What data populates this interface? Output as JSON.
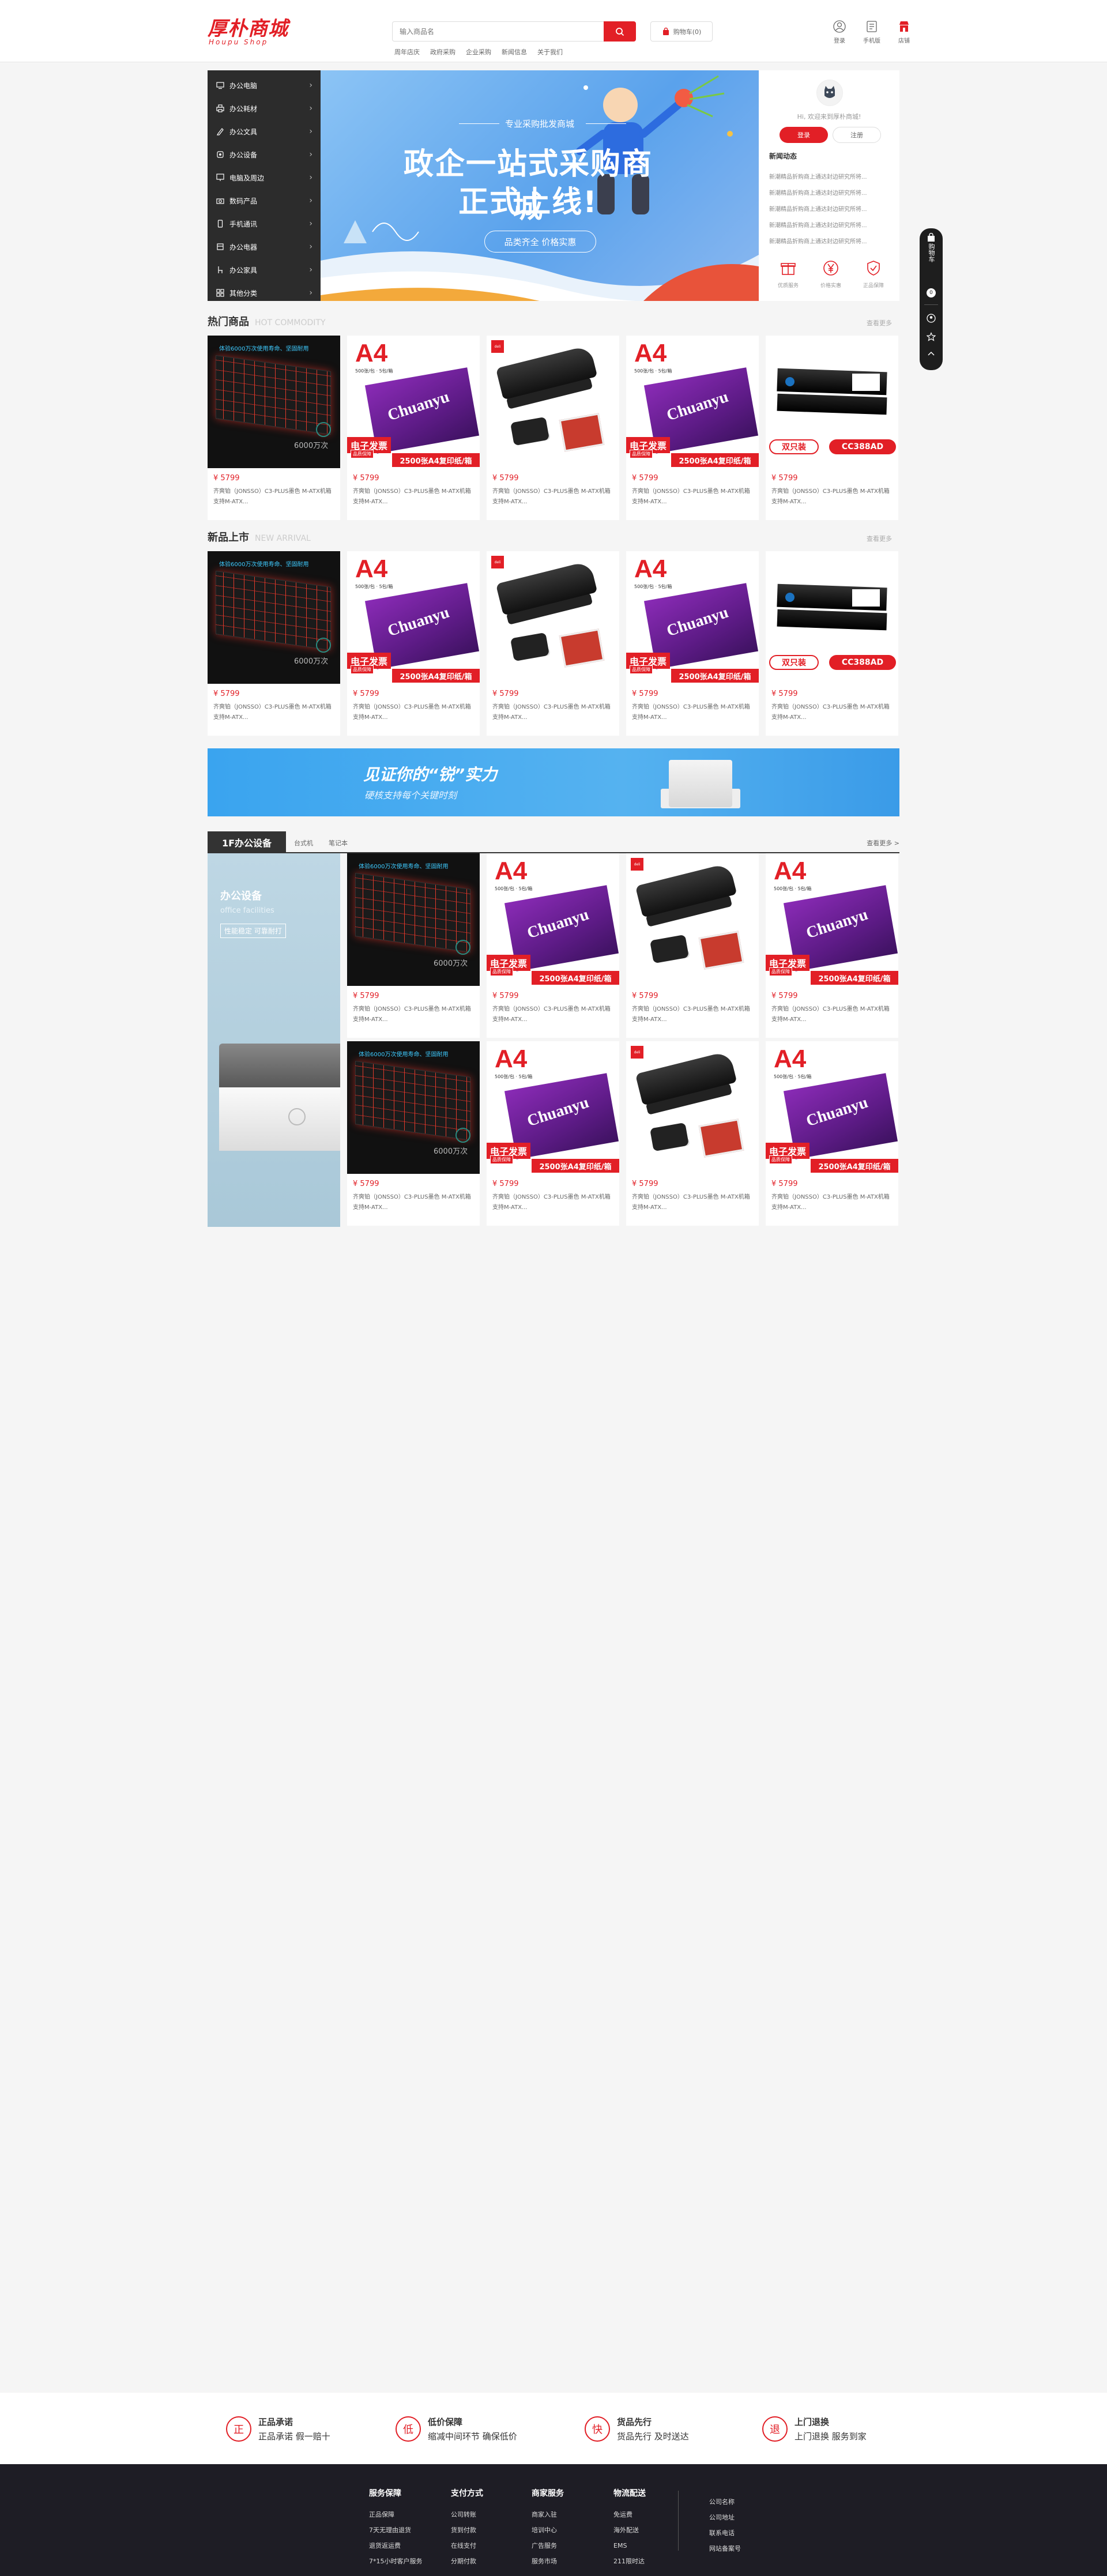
{
  "header": {
    "logo_cn": "厚朴商城",
    "logo_en": "Houpu Shop",
    "search_placeholder": "输入商品名",
    "cart_label": "购物车(0)",
    "hot_words": [
      "周年店庆",
      "政府采购",
      "企业采购",
      "新闻信息",
      "关于我们"
    ],
    "icons": [
      {
        "label": "登录",
        "icon": "user-icon"
      },
      {
        "label": "手机版",
        "icon": "mobile-icon"
      },
      {
        "label": "店铺",
        "icon": "store-icon"
      }
    ]
  },
  "categories": [
    {
      "label": "办公电脑",
      "icon": "computer-icon"
    },
    {
      "label": "办公耗材",
      "icon": "printer-icon"
    },
    {
      "label": "办公文具",
      "icon": "pen-icon"
    },
    {
      "label": "办公设备",
      "icon": "device-icon"
    },
    {
      "label": "电脑及周边",
      "icon": "monitor-icon"
    },
    {
      "label": "数码产品",
      "icon": "camera-icon"
    },
    {
      "label": "手机通讯",
      "icon": "phone-icon"
    },
    {
      "label": "办公电器",
      "icon": "appliance-icon"
    },
    {
      "label": "办公家具",
      "icon": "chair-icon"
    },
    {
      "label": "其他分类",
      "icon": "grid-icon"
    }
  ],
  "banner": {
    "subtitle": "专业采购批发商城",
    "title_line1": "政企一站式采购商城",
    "title_line2": "正式上线!",
    "pill": "品类齐全 价格实惠",
    "dot_count": 4,
    "active_dot": 1
  },
  "user_panel": {
    "greeting": "Hi, 欢迎来到厚朴商城!",
    "login_label": "登录",
    "register_label": "注册",
    "news_title": "新闻动态",
    "news": [
      "新潮精品折购商上通达封边研究所将...",
      "新潮精品折购商上通达封边研究所将...",
      "新潮精品折购商上通达封边研究所将...",
      "新潮精品折购商上通达封边研究所将...",
      "新潮精品折购商上通达封边研究所将..."
    ],
    "services": [
      {
        "label": "优质服务",
        "icon": "gift-icon"
      },
      {
        "label": "价格实惠",
        "icon": "yen-icon"
      },
      {
        "label": "正品保障",
        "icon": "shield-icon"
      }
    ]
  },
  "hot_section": {
    "title": "热门商品",
    "title_en": "HOT COMMODITY",
    "more": "查看更多"
  },
  "new_section": {
    "title": "新品上市",
    "title_en": "NEW ARRIVAL",
    "more": "查看更多"
  },
  "products": [
    {
      "type": "keyboard",
      "price": "¥ 5799",
      "name": "齐爽铂（JONSSO）C3-PLUS墨色 M-ATX机箱支持M-ATX...",
      "kb_text": "体验6000万次使用寿命、坚固耐用",
      "kb_count": "6000万次"
    },
    {
      "type": "paper",
      "price": "¥ 5799",
      "name": "齐爽铂（JONSSO）C3-PLUS墨色 M-ATX机箱支持M-ATX...",
      "a4": "A4",
      "paper_tag": "500张/包 · 5包/箱",
      "brand": "Chuanyu",
      "badge": "电子发票",
      "badge2": "品质保障",
      "strip": "2500张A4复印纸/箱"
    },
    {
      "type": "stapler",
      "price": "¥ 5799",
      "name": "齐爽铂（JONSSO）C3-PLUS墨色 M-ATX机箱支持M-ATX...",
      "logo": "deli"
    },
    {
      "type": "paper",
      "price": "¥ 5799",
      "name": "齐爽铂（JONSSO）C3-PLUS墨色 M-ATX机箱支持M-ATX...",
      "a4": "A4",
      "paper_tag": "500张/包 · 5包/箱",
      "brand": "Chuanyu",
      "badge": "电子发票",
      "badge2": "品质保障",
      "strip": "2500张A4复印纸/箱"
    },
    {
      "type": "toner",
      "price": "¥ 5799",
      "name": "齐爽铂（JONSSO）C3-PLUS墨色 M-ATX机箱支持M-ATX...",
      "dual": "双只装",
      "model": "CC388AD"
    }
  ],
  "mid_banner": {
    "title": "见证你的“锐”实力",
    "subtitle": "硬核支持每个关键时刻"
  },
  "floor": {
    "tag": "1F办公设备",
    "tabs": [
      "台式机",
      "笔记本"
    ],
    "more": "查看更多 >",
    "banner_title": "办公设备",
    "banner_en": "office facilities",
    "banner_btn": "性能稳定 可靠耐打"
  },
  "floor_products": [
    {
      "type": "keyboard",
      "price": "¥ 5799",
      "name": "齐爽铂（JONSSO）C3-PLUS墨色 M-ATX机箱支持M-ATX...",
      "kb_text": "体验6000万次使用寿命、坚固耐用",
      "kb_count": "6000万次"
    },
    {
      "type": "paper",
      "price": "¥ 5799",
      "name": "齐爽铂（JONSSO）C3-PLUS墨色 M-ATX机箱支持M-ATX...",
      "a4": "A4",
      "paper_tag": "500张/包 · 5包/箱",
      "brand": "Chuanyu",
      "badge": "电子发票",
      "badge2": "品质保障",
      "strip": "2500张A4复印纸/箱"
    },
    {
      "type": "stapler",
      "price": "¥ 5799",
      "name": "齐爽铂（JONSSO）C3-PLUS墨色 M-ATX机箱支持M-ATX...",
      "logo": "deli"
    },
    {
      "type": "paper",
      "price": "¥ 5799",
      "name": "齐爽铂（JONSSO）C3-PLUS墨色 M-ATX机箱支持M-ATX...",
      "a4": "A4",
      "paper_tag": "500张/包 · 5包/箱",
      "brand": "Chuanyu",
      "badge": "电子发票",
      "badge2": "品质保障",
      "strip": "2500张A4复印纸/箱"
    },
    {
      "type": "keyboard",
      "price": "¥ 5799",
      "name": "齐爽铂（JONSSO）C3-PLUS墨色 M-ATX机箱支持M-ATX...",
      "kb_text": "体验6000万次使用寿命、坚固耐用",
      "kb_count": "6000万次"
    },
    {
      "type": "paper",
      "price": "¥ 5799",
      "name": "齐爽铂（JONSSO）C3-PLUS墨色 M-ATX机箱支持M-ATX...",
      "a4": "A4",
      "paper_tag": "500张/包 · 5包/箱",
      "brand": "Chuanyu",
      "badge": "电子发票",
      "badge2": "品质保障",
      "strip": "2500张A4复印纸/箱"
    },
    {
      "type": "stapler",
      "price": "¥ 5799",
      "name": "齐爽铂（JONSSO）C3-PLUS墨色 M-ATX机箱支持M-ATX...",
      "logo": "deli"
    },
    {
      "type": "paper",
      "price": "¥ 5799",
      "name": "齐爽铂（JONSSO）C3-PLUS墨色 M-ATX机箱支持M-ATX...",
      "a4": "A4",
      "paper_tag": "500张/包 · 5包/箱",
      "brand": "Chuanyu",
      "badge": "电子发票",
      "badge2": "品质保障",
      "strip": "2500张A4复印纸/箱"
    }
  ],
  "guarantees": [
    {
      "icon_char": "正",
      "title": "正品承诺",
      "desc": "正品承诺 假一赔十"
    },
    {
      "icon_char": "低",
      "title": "低价保障",
      "desc": "缩减中间环节 确保低价"
    },
    {
      "icon_char": "快",
      "title": "货品先行",
      "desc": "货品先行 及时送达"
    },
    {
      "icon_char": "退",
      "title": "上门退换",
      "desc": "上门退换 服务到家"
    }
  ],
  "footer": {
    "columns": [
      {
        "title": "服务保障",
        "items": [
          "正品保障",
          "7天无理由退货",
          "退货返运费",
          "7*15小时客户服务"
        ]
      },
      {
        "title": "支付方式",
        "items": [
          "公司转账",
          "货到付款",
          "在线支付",
          "分期付款"
        ]
      },
      {
        "title": "商家服务",
        "items": [
          "商家入驻",
          "培训中心",
          "广告服务",
          "服务市场"
        ]
      },
      {
        "title": "物流配送",
        "items": [
          "免运费",
          "海外配送",
          "EMS",
          "211限时达"
        ]
      }
    ],
    "info": [
      "公司名称",
      "公司地址",
      "联系电话",
      "网站备案号"
    ]
  },
  "float_bar": {
    "cart_text": "购物车",
    "count": "0"
  },
  "colors": {
    "accent": "#e21f26",
    "dark": "#2c2c2c",
    "footer_bg": "#1e1d25"
  }
}
